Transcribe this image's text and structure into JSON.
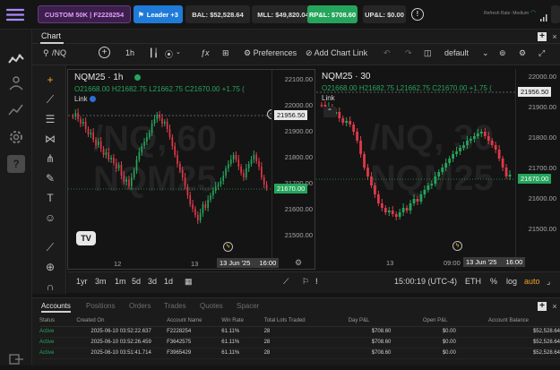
{
  "topbar": {
    "account_label": "CUSTOM 50K | F2228254",
    "leader_label": "Leader +3",
    "bal": "BAL: $52,528.64",
    "mll": "MLL: $49,820.04",
    "rpl": "RP&L: $708.60",
    "upl": "UP&L: $0.00",
    "info_icon": "info-icon",
    "refresh": "Refresh Rate: Medium",
    "colors": {
      "account": "#d36cf5",
      "leader": "#1f7bd8",
      "rpl": "#24a55b"
    }
  },
  "chart_tab": {
    "label": "Chart"
  },
  "toolbar": {
    "symbol": "/NQ",
    "interval": "1h",
    "preferences": "Preferences",
    "add_alert": "Add Chart Link",
    "layout_name": "default"
  },
  "pane1": {
    "title": "NQM25 · 1h",
    "ohlc_o": "O21668.00",
    "ohlc_h": "H21682.75",
    "ohlc_l": "L21662.75",
    "ohlc_c": "C21670.00",
    "ohlc_chg": "+1.75 (",
    "link": "Link",
    "watermark1": "/NQ, 60",
    "watermark2": "NQM25",
    "y_ticks": [
      "22100.00",
      "22000.00",
      "21900.00",
      "21800.00",
      "21700.00",
      "21600.00",
      "21500.00"
    ],
    "crosshair_price": "21956.50",
    "last_price": "21670.00",
    "x_ticks": [
      "12",
      "13"
    ],
    "date_box": "13 Jun '25",
    "time_box": "16:00"
  },
  "pane2": {
    "title": "NQM25 · 30",
    "ohlc_o": "O21668.00",
    "ohlc_h": "H21682.75",
    "ohlc_l": "L21662.75",
    "ohlc_c": "C21670.00",
    "ohlc_chg": "+1.75 (",
    "link": "Link",
    "watermark1": "/NQ, 30",
    "watermark2": "NQM25",
    "y_ticks": [
      "22000.00",
      "21900.00",
      "21800.00",
      "21700.00",
      "21600.00",
      "21500.00"
    ],
    "crosshair_price": "21956.50",
    "last_price": "21670.00",
    "x_ticks": [
      "13",
      "09:00"
    ],
    "date_box": "13 Jun '25",
    "time_box": "16:00"
  },
  "bottombar": {
    "ranges": [
      "1yr",
      "3m",
      "1m",
      "5d",
      "3d",
      "1d"
    ],
    "clock": "15:00:19 (UTC-4)",
    "session": "ETH",
    "pct": "%",
    "log": "log",
    "auto": "auto"
  },
  "accounts": {
    "tabs": [
      "Accounts",
      "Positions",
      "Orders",
      "Trades",
      "Quotes",
      "Spacer"
    ],
    "columns": [
      "Status",
      "Created On",
      "Account Name",
      "Win Rate",
      "Total Lots Traded",
      "Day P&L",
      "Open P&L",
      "Account Balance"
    ],
    "rows": [
      [
        "Active",
        "2025-06-10 03:52:22.637",
        "F2228254",
        "61.11%",
        "28",
        "$708.60",
        "$0.00",
        "$52,528.64"
      ],
      [
        "Active",
        "2025-06-10 03:52:26.459",
        "F3642575",
        "61.11%",
        "28",
        "$708.60",
        "$0.00",
        "$52,528.64"
      ],
      [
        "Active",
        "2025-06-10 03:51:41.714",
        "F3965429",
        "61.11%",
        "28",
        "$708.60",
        "$0.00",
        "$52,528.64"
      ]
    ]
  }
}
